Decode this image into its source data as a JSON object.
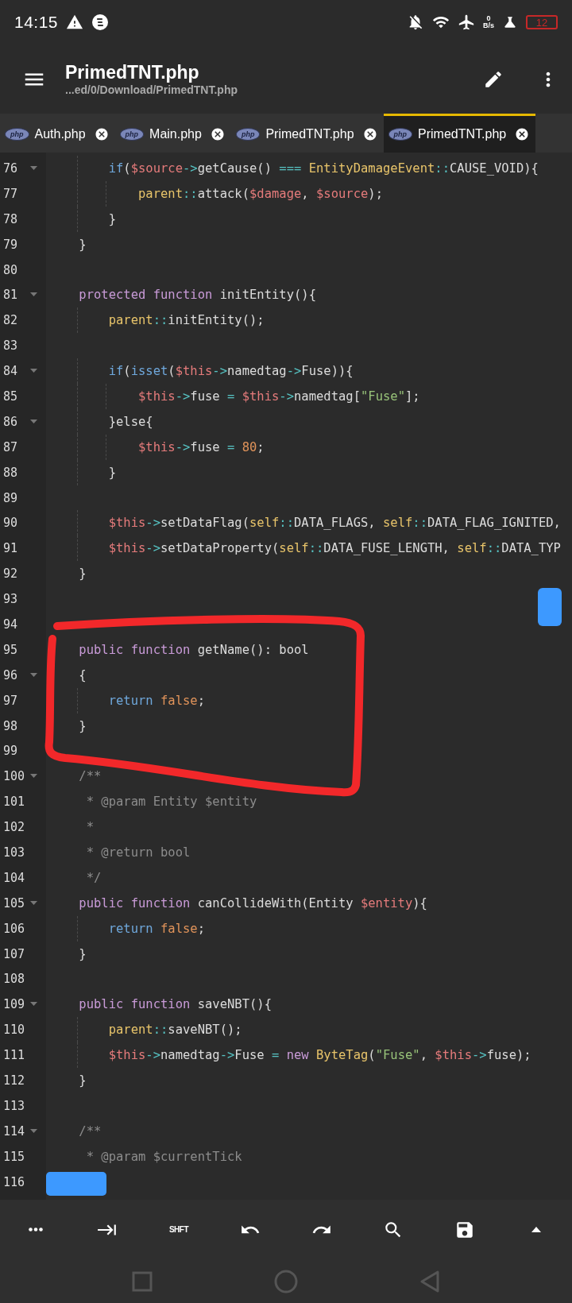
{
  "status_bar": {
    "time": "14:15",
    "net_speed_value": "0",
    "net_speed_unit": "B/s",
    "battery": "12"
  },
  "app_bar": {
    "title": "PrimedTNT.php",
    "path": "...ed/0/Download/PrimedTNT.php"
  },
  "tabs": [
    {
      "label": "Auth.php",
      "badge": "php",
      "selected": false
    },
    {
      "label": "Main.php",
      "badge": "php",
      "selected": false
    },
    {
      "label": "PrimedTNT.php",
      "badge": "php",
      "selected": false
    },
    {
      "label": "PrimedTNT.php",
      "badge": "php",
      "selected": true
    }
  ],
  "editor": {
    "lines": [
      {
        "number": "76",
        "fold": true,
        "tokens": [
          {
            "t": "        if",
            "kind": "ctl"
          },
          {
            "t": "(",
            "kind": "plain"
          },
          {
            "t": "$source",
            "kind": "var"
          },
          {
            "t": "->",
            "kind": "op"
          },
          {
            "t": "getCause() ",
            "kind": "plain"
          },
          {
            "t": "=== ",
            "kind": "op"
          },
          {
            "t": "EntityDamageEvent",
            "kind": "cls"
          },
          {
            "t": "::",
            "kind": "op"
          },
          {
            "t": "CAUSE_VOID){",
            "kind": "plain"
          }
        ]
      },
      {
        "number": "77",
        "fold": false,
        "tokens": [
          {
            "t": "            parent",
            "kind": "cls"
          },
          {
            "t": "::",
            "kind": "op"
          },
          {
            "t": "attack(",
            "kind": "plain"
          },
          {
            "t": "$damage",
            "kind": "var"
          },
          {
            "t": ", ",
            "kind": "plain"
          },
          {
            "t": "$source",
            "kind": "var"
          },
          {
            "t": ");",
            "kind": "plain"
          }
        ]
      },
      {
        "number": "78",
        "fold": false,
        "tokens": [
          {
            "t": "        }",
            "kind": "plain"
          }
        ]
      },
      {
        "number": "79",
        "fold": false,
        "tokens": [
          {
            "t": "    }",
            "kind": "plain"
          }
        ]
      },
      {
        "number": "80",
        "fold": false
      },
      {
        "number": "81",
        "fold": true,
        "tokens": [
          {
            "t": "    protected function",
            "kind": "kw"
          },
          {
            "t": " initEntity(){",
            "kind": "plain"
          }
        ]
      },
      {
        "number": "82",
        "fold": false,
        "tokens": [
          {
            "t": "        parent",
            "kind": "cls"
          },
          {
            "t": "::",
            "kind": "op"
          },
          {
            "t": "initEntity();",
            "kind": "plain"
          }
        ]
      },
      {
        "number": "83",
        "fold": false
      },
      {
        "number": "84",
        "fold": true,
        "tokens": [
          {
            "t": "        if",
            "kind": "ctl"
          },
          {
            "t": "(",
            "kind": "plain"
          },
          {
            "t": "isset",
            "kind": "ctl"
          },
          {
            "t": "(",
            "kind": "plain"
          },
          {
            "t": "$this",
            "kind": "var"
          },
          {
            "t": "->",
            "kind": "op"
          },
          {
            "t": "namedtag",
            "kind": "plain"
          },
          {
            "t": "->",
            "kind": "op"
          },
          {
            "t": "Fuse)){",
            "kind": "plain"
          }
        ]
      },
      {
        "number": "85",
        "fold": false,
        "tokens": [
          {
            "t": "            $this",
            "kind": "var"
          },
          {
            "t": "->",
            "kind": "op"
          },
          {
            "t": "fuse ",
            "kind": "plain"
          },
          {
            "t": "= ",
            "kind": "op"
          },
          {
            "t": "$this",
            "kind": "var"
          },
          {
            "t": "->",
            "kind": "op"
          },
          {
            "t": "namedtag[",
            "kind": "plain"
          },
          {
            "t": "\"Fuse\"",
            "kind": "str"
          },
          {
            "t": "];",
            "kind": "plain"
          }
        ]
      },
      {
        "number": "86",
        "fold": true,
        "tokens": [
          {
            "t": "        }else{",
            "kind": "plain"
          }
        ]
      },
      {
        "number": "87",
        "fold": false,
        "tokens": [
          {
            "t": "            $this",
            "kind": "var"
          },
          {
            "t": "->",
            "kind": "op"
          },
          {
            "t": "fuse ",
            "kind": "plain"
          },
          {
            "t": "= ",
            "kind": "op"
          },
          {
            "t": "80",
            "kind": "num"
          },
          {
            "t": ";",
            "kind": "plain"
          }
        ]
      },
      {
        "number": "88",
        "fold": false,
        "tokens": [
          {
            "t": "        }",
            "kind": "plain"
          }
        ]
      },
      {
        "number": "89",
        "fold": false
      },
      {
        "number": "90",
        "fold": false,
        "tokens": [
          {
            "t": "        $this",
            "kind": "var"
          },
          {
            "t": "->",
            "kind": "op"
          },
          {
            "t": "setDataFlag(",
            "kind": "plain"
          },
          {
            "t": "self",
            "kind": "cls"
          },
          {
            "t": "::",
            "kind": "op"
          },
          {
            "t": "DATA_FLAGS, ",
            "kind": "plain"
          },
          {
            "t": "self",
            "kind": "cls"
          },
          {
            "t": "::",
            "kind": "op"
          },
          {
            "t": "DATA_FLAG_IGNITED,",
            "kind": "plain"
          }
        ]
      },
      {
        "number": "91",
        "fold": false,
        "tokens": [
          {
            "t": "        $this",
            "kind": "var"
          },
          {
            "t": "->",
            "kind": "op"
          },
          {
            "t": "setDataProperty(",
            "kind": "plain"
          },
          {
            "t": "self",
            "kind": "cls"
          },
          {
            "t": "::",
            "kind": "op"
          },
          {
            "t": "DATA_FUSE_LENGTH, ",
            "kind": "plain"
          },
          {
            "t": "self",
            "kind": "cls"
          },
          {
            "t": "::",
            "kind": "op"
          },
          {
            "t": "DATA_TYP",
            "kind": "plain"
          }
        ]
      },
      {
        "number": "92",
        "fold": false,
        "tokens": [
          {
            "t": "    }",
            "kind": "plain"
          }
        ]
      },
      {
        "number": "93",
        "fold": false
      },
      {
        "number": "94",
        "fold": false
      },
      {
        "number": "95",
        "fold": false,
        "tokens": [
          {
            "t": "    public function",
            "kind": "kw"
          },
          {
            "t": " getName(): bool",
            "kind": "plain"
          }
        ]
      },
      {
        "number": "96",
        "fold": true,
        "tokens": [
          {
            "t": "    {",
            "kind": "plain"
          }
        ]
      },
      {
        "number": "97",
        "fold": false,
        "tokens": [
          {
            "t": "        return ",
            "kind": "ctl"
          },
          {
            "t": "false",
            "kind": "num"
          },
          {
            "t": ";",
            "kind": "plain"
          }
        ]
      },
      {
        "number": "98",
        "fold": false,
        "tokens": [
          {
            "t": "    }",
            "kind": "plain"
          }
        ]
      },
      {
        "number": "99",
        "fold": false
      },
      {
        "number": "100",
        "fold": true,
        "tokens": [
          {
            "t": "    /**",
            "kind": "cmt"
          }
        ]
      },
      {
        "number": "101",
        "fold": false,
        "tokens": [
          {
            "t": "     * @param Entity $entity",
            "kind": "cmt"
          }
        ]
      },
      {
        "number": "102",
        "fold": false,
        "tokens": [
          {
            "t": "     *",
            "kind": "cmt"
          }
        ]
      },
      {
        "number": "103",
        "fold": false,
        "tokens": [
          {
            "t": "     * @return bool",
            "kind": "cmt"
          }
        ]
      },
      {
        "number": "104",
        "fold": false,
        "tokens": [
          {
            "t": "     */",
            "kind": "cmt"
          }
        ]
      },
      {
        "number": "105",
        "fold": true,
        "tokens": [
          {
            "t": "    public function",
            "kind": "kw"
          },
          {
            "t": " canCollideWith(Entity ",
            "kind": "plain"
          },
          {
            "t": "$entity",
            "kind": "var"
          },
          {
            "t": "){",
            "kind": "plain"
          }
        ]
      },
      {
        "number": "106",
        "fold": false,
        "tokens": [
          {
            "t": "        return ",
            "kind": "ctl"
          },
          {
            "t": "false",
            "kind": "num"
          },
          {
            "t": ";",
            "kind": "plain"
          }
        ]
      },
      {
        "number": "107",
        "fold": false,
        "tokens": [
          {
            "t": "    }",
            "kind": "plain"
          }
        ]
      },
      {
        "number": "108",
        "fold": false
      },
      {
        "number": "109",
        "fold": true,
        "tokens": [
          {
            "t": "    public function",
            "kind": "kw"
          },
          {
            "t": " saveNBT(){",
            "kind": "plain"
          }
        ]
      },
      {
        "number": "110",
        "fold": false,
        "tokens": [
          {
            "t": "        parent",
            "kind": "cls"
          },
          {
            "t": "::",
            "kind": "op"
          },
          {
            "t": "saveNBT();",
            "kind": "plain"
          }
        ]
      },
      {
        "number": "111",
        "fold": false,
        "tokens": [
          {
            "t": "        $this",
            "kind": "var"
          },
          {
            "t": "->",
            "kind": "op"
          },
          {
            "t": "namedtag",
            "kind": "plain"
          },
          {
            "t": "->",
            "kind": "op"
          },
          {
            "t": "Fuse ",
            "kind": "plain"
          },
          {
            "t": "= ",
            "kind": "op"
          },
          {
            "t": "new ",
            "kind": "kw"
          },
          {
            "t": "ByteTag",
            "kind": "cls"
          },
          {
            "t": "(",
            "kind": "plain"
          },
          {
            "t": "\"Fuse\"",
            "kind": "str"
          },
          {
            "t": ", ",
            "kind": "plain"
          },
          {
            "t": "$this",
            "kind": "var"
          },
          {
            "t": "->",
            "kind": "op"
          },
          {
            "t": "fuse);",
            "kind": "plain"
          }
        ]
      },
      {
        "number": "112",
        "fold": false,
        "tokens": [
          {
            "t": "    }",
            "kind": "plain"
          }
        ]
      },
      {
        "number": "113",
        "fold": false
      },
      {
        "number": "114",
        "fold": true,
        "tokens": [
          {
            "t": "    /**",
            "kind": "cmt"
          }
        ]
      },
      {
        "number": "115",
        "fold": false,
        "tokens": [
          {
            "t": "     * @param $currentTick",
            "kind": "cmt"
          }
        ]
      },
      {
        "number": "116",
        "fold": false
      }
    ]
  },
  "toolbar": [
    {
      "kind": "more"
    },
    {
      "kind": "tab"
    },
    {
      "kind": "text",
      "label": "SHFT"
    },
    {
      "kind": "undo"
    },
    {
      "kind": "redo"
    },
    {
      "kind": "search"
    },
    {
      "kind": "save"
    },
    {
      "kind": "expand"
    }
  ]
}
